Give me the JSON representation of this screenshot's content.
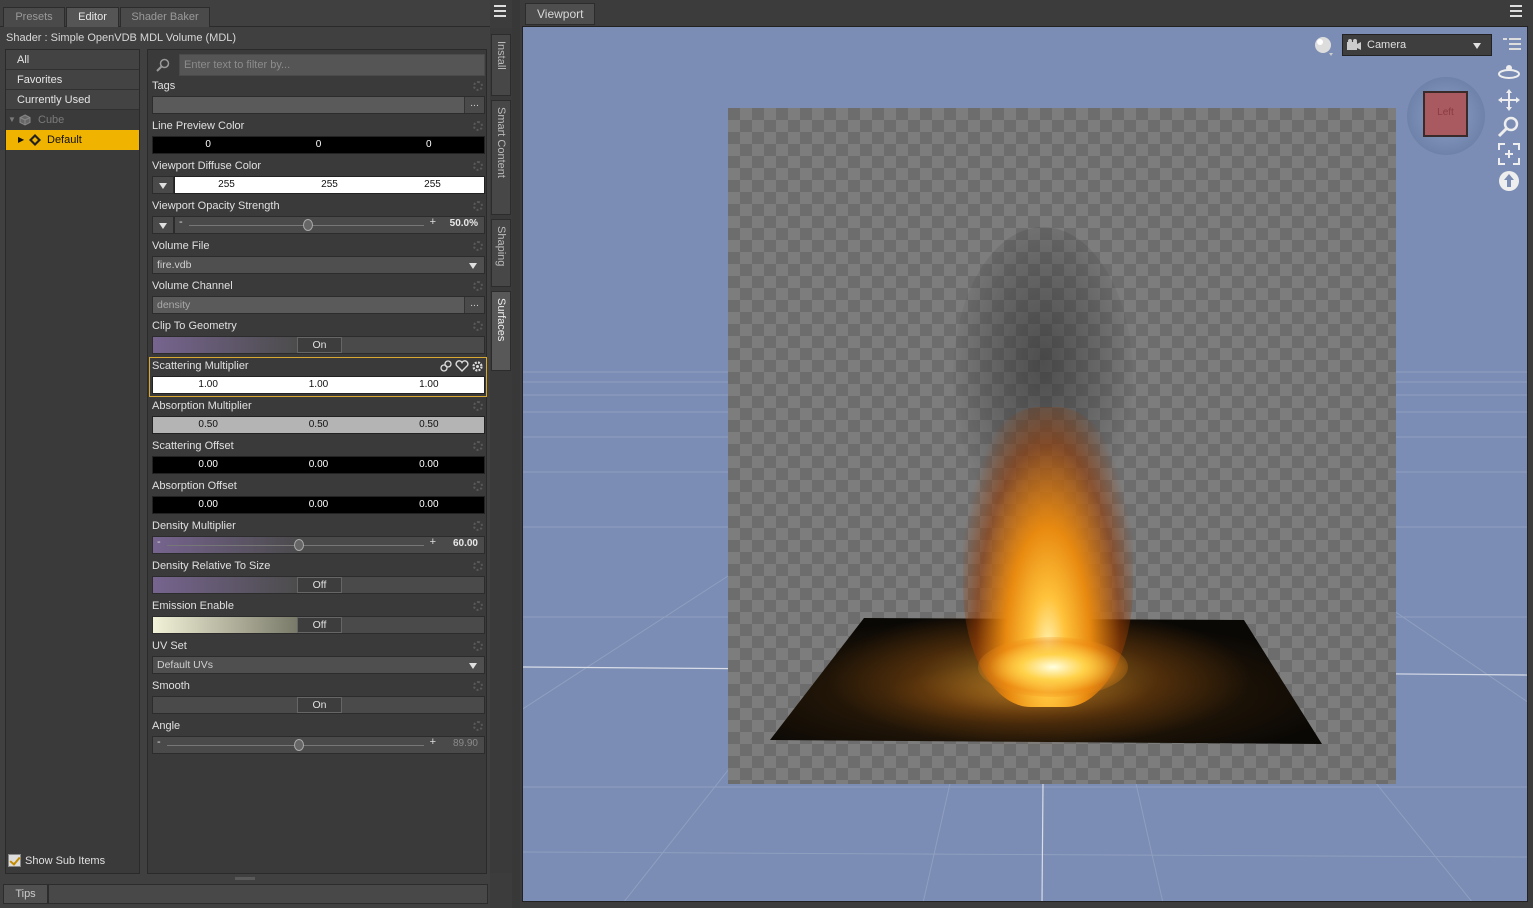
{
  "tabs": [
    "Presets",
    "Editor",
    "Shader Baker"
  ],
  "active_tab": "Editor",
  "shader_title": "Shader : Simple OpenVDB MDL Volume (MDL)",
  "groups": [
    "All",
    "Favorites",
    "Currently Used"
  ],
  "tree": {
    "object": "Cube",
    "surface": "Default"
  },
  "filter_placeholder": "Enter text to filter by...",
  "properties": {
    "tags": {
      "label": "Tags",
      "value": "",
      "more": "..."
    },
    "line_preview_color": {
      "label": "Line Preview Color",
      "values": [
        "0",
        "0",
        "0"
      ]
    },
    "viewport_diffuse_color": {
      "label": "Viewport Diffuse Color",
      "values": [
        "255",
        "255",
        "255"
      ]
    },
    "viewport_opacity_strength": {
      "label": "Viewport Opacity Strength",
      "value": "50.0%",
      "level": 0.5
    },
    "volume_file": {
      "label": "Volume File",
      "value": "fire.vdb"
    },
    "volume_channel": {
      "label": "Volume Channel",
      "value": "density",
      "more": "..."
    },
    "clip_to_geometry": {
      "label": "Clip To Geometry",
      "state": "On"
    },
    "scattering_multiplier": {
      "label": "Scattering Multiplier",
      "values": [
        "1.00",
        "1.00",
        "1.00"
      ]
    },
    "absorption_multiplier": {
      "label": "Absorption Multiplier",
      "values": [
        "0.50",
        "0.50",
        "0.50"
      ]
    },
    "scattering_offset": {
      "label": "Scattering Offset",
      "values": [
        "0.00",
        "0.00",
        "0.00"
      ]
    },
    "absorption_offset": {
      "label": "Absorption Offset",
      "values": [
        "0.00",
        "0.00",
        "0.00"
      ]
    },
    "density_multiplier": {
      "label": "Density Multiplier",
      "value": "60.00",
      "level": 0.5
    },
    "density_relative_to_size": {
      "label": "Density Relative To Size",
      "state": "Off"
    },
    "emission_enable": {
      "label": "Emission Enable",
      "state": "Off"
    },
    "uv_set": {
      "label": "UV Set",
      "value": "Default UVs"
    },
    "smooth": {
      "label": "Smooth",
      "state": "On"
    },
    "angle": {
      "label": "Angle",
      "value": "89.90",
      "level": 0.5
    }
  },
  "side_tabs": [
    "Install",
    "Smart Content",
    "Shaping",
    "Surfaces"
  ],
  "active_side_tab": "Surfaces",
  "show_sub_items": {
    "label": "Show Sub Items",
    "checked": true
  },
  "tips_label": "Tips",
  "viewport": {
    "tab_label": "Viewport",
    "camera": "Camera",
    "nav_cube_face": "Left",
    "background_color": "#7b8db4"
  }
}
